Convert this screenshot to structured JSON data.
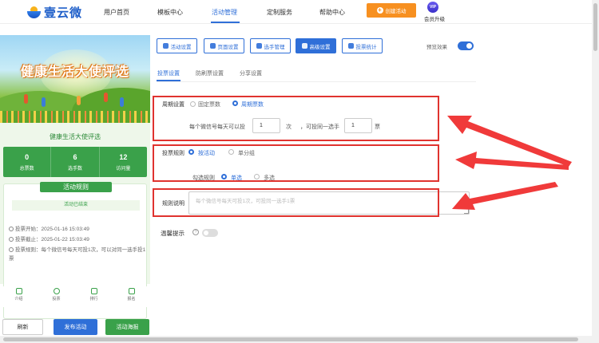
{
  "brand": {
    "name": "壹云微"
  },
  "nav": {
    "items": [
      "用户首页",
      "模板中心",
      "活动管理",
      "定制服务",
      "帮助中心"
    ],
    "create_label": "创建活动",
    "vip_badge": "VIP",
    "vip_label": "会员升级"
  },
  "preview": {
    "banner_title": "健康生活大使评选",
    "event_name": "健康生活大使评选",
    "stats": [
      {
        "value": "0",
        "label": "总票数"
      },
      {
        "value": "6",
        "label": "选手数"
      },
      {
        "value": "12",
        "label": "访问量"
      }
    ],
    "rules_title": "活动规则",
    "status": "活动已结束",
    "info": [
      "投票开始：2025-01-16 15:03:49",
      "投票截止：2025-01-22 15:03:49",
      "投票规则：每个微信号每天可投1次，可以对同一选手投1票"
    ],
    "tabs": [
      "介绍",
      "投票",
      "排行",
      "报名"
    ]
  },
  "left_buttons": {
    "refresh": "刷新",
    "publish": "发布活动",
    "poster": "活动海报"
  },
  "toolbar": {
    "buttons": [
      "活动设置",
      "页面设置",
      "选手管理",
      "高级设置",
      "投票统计"
    ],
    "preview_label": "预览效果"
  },
  "subtabs": [
    "投票设置",
    "防刷票设置",
    "分享设置"
  ],
  "settings": {
    "cycle_label": "周期设置",
    "cycle_options": [
      "固定票数",
      "周期票数"
    ],
    "per_day_prefix": "每个微信号每天可以投",
    "per_day_value": "1",
    "per_day_unit": "次",
    "same_player_prefix": "，可投同一选手",
    "same_player_value": "1",
    "same_player_unit": "票",
    "rule_label": "投票规则",
    "rule_options": [
      "按活动",
      "单分组"
    ],
    "select_label": "勾选规则",
    "select_options": [
      "单选",
      "多选"
    ],
    "desc_label": "规则说明",
    "desc_placeholder": "每个微信号每天可投1次，可投同一选手1票",
    "tip_label": "温馨提示",
    "help_glyph": "?"
  }
}
